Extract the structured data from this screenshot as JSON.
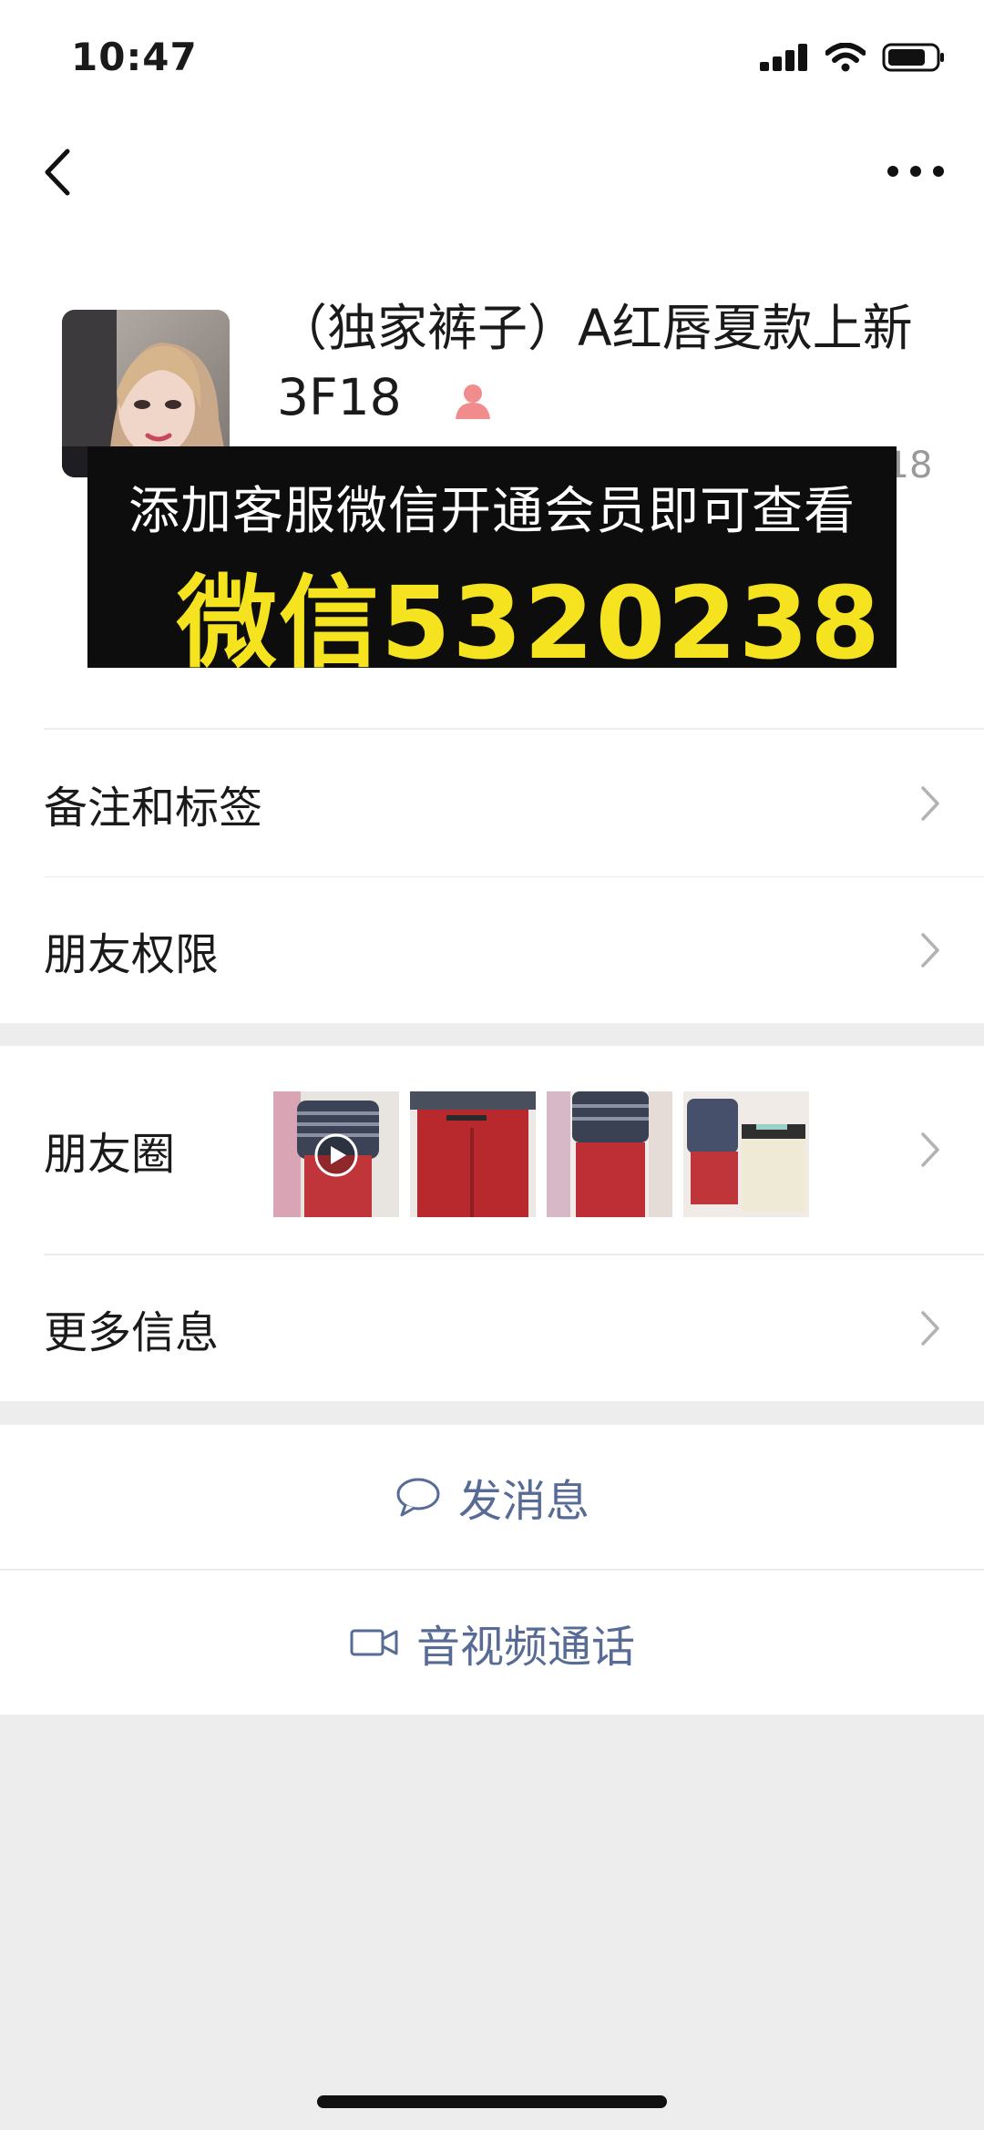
{
  "status_bar": {
    "time": "10:47"
  },
  "contact": {
    "name": "（独家裤子）A红唇夏款上新 3F18",
    "nickname_partial": "昵称：（独家裤子）A红唇夏款上新 3F18"
  },
  "promo_banner": {
    "line1": "添加客服微信开通会员即可查看",
    "line2": "微信5320238"
  },
  "settings": {
    "remark_label": "备注和标签",
    "permissions_label": "朋友权限",
    "moments_label": "朋友圈",
    "more_info_label": "更多信息"
  },
  "actions": {
    "message_label": "发消息",
    "call_label": "音视频通话"
  },
  "colors": {
    "link": "#576b95",
    "promo_text": "#f6e31f",
    "background": "#ededed"
  }
}
